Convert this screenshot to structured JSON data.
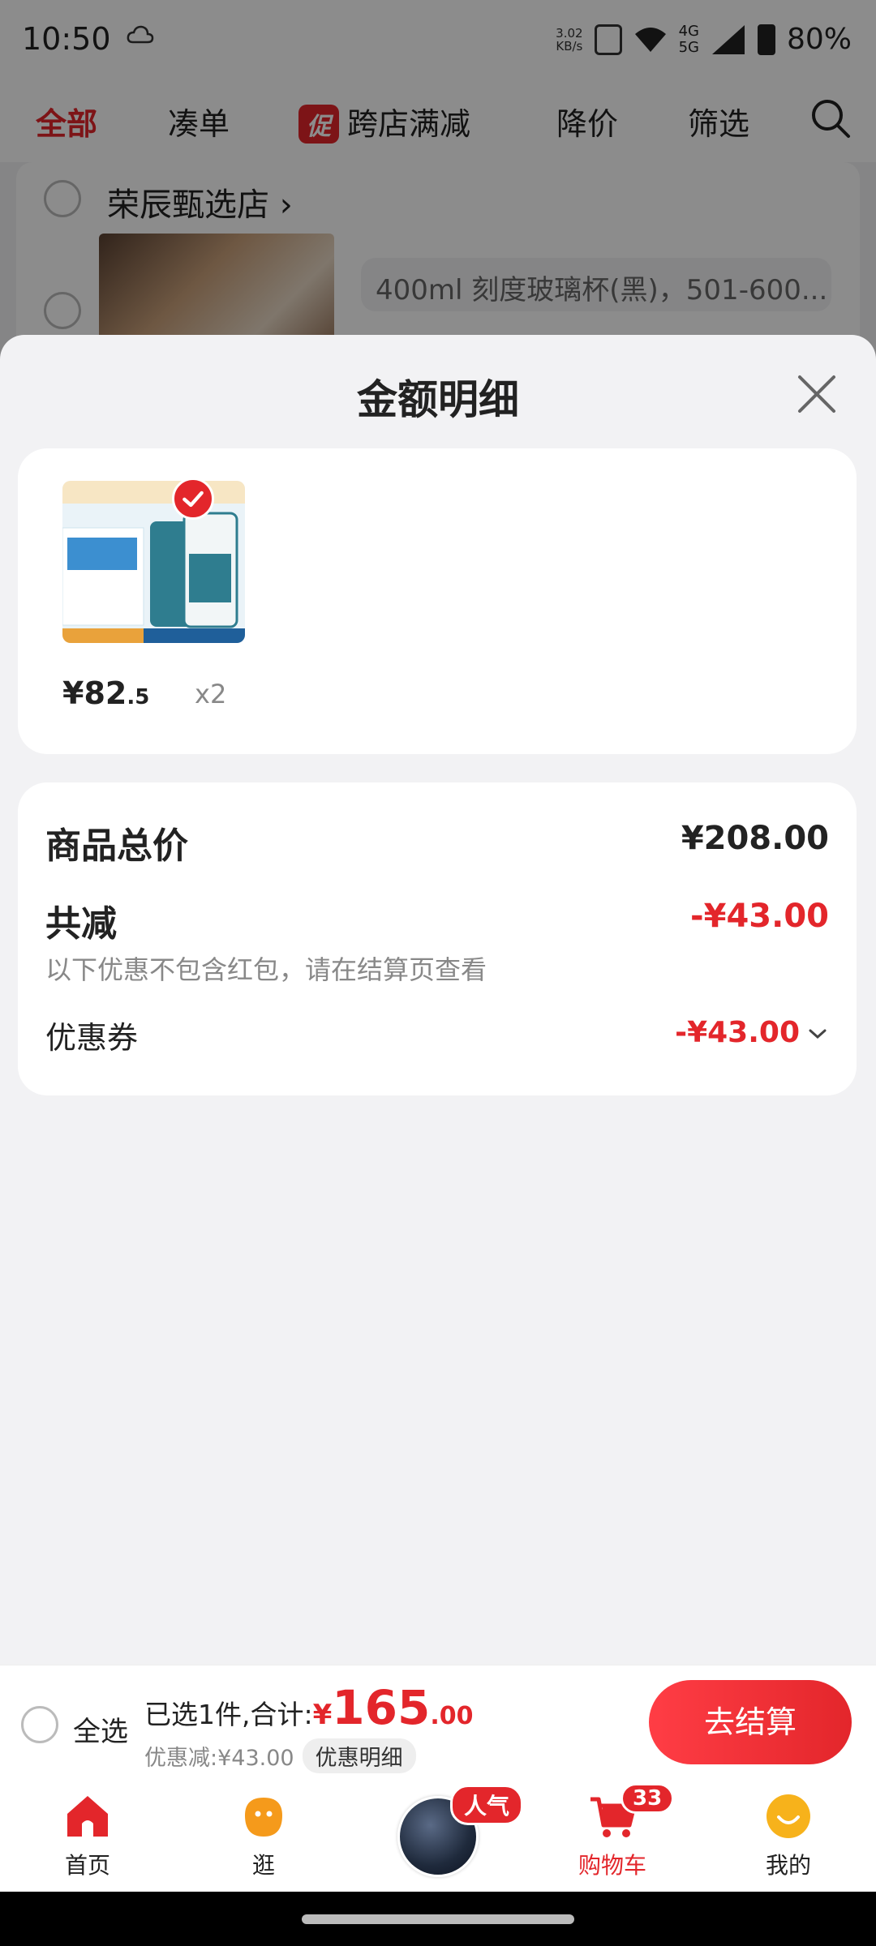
{
  "status_bar": {
    "time": "10:50",
    "net_speed_value": "3.02",
    "net_speed_unit": "KB/s",
    "net_type_top": "4G",
    "net_type_bottom": "5G",
    "battery": "80%"
  },
  "tabs": {
    "all": "全部",
    "bundle": "凑单",
    "promo_badge": "促",
    "cross_store": "跨店满减",
    "price_drop": "降价",
    "filter": "筛选"
  },
  "background_store": {
    "name": "荣辰甄选店",
    "spec": "400ml 刻度玻璃杯(黑)，501-600..."
  },
  "sheet": {
    "title": "金额明细",
    "item": {
      "price_main": "¥82",
      "price_decimal": ".5",
      "quantity": "x2"
    },
    "summary": {
      "total_label": "商品总价",
      "total_value": "¥208.00",
      "reduction_label": "共减",
      "reduction_value": "-¥43.00",
      "note": "以下优惠不包含红包，请在结算页查看",
      "coupon_label": "优惠券",
      "coupon_value": "-¥43.00"
    }
  },
  "action_bar": {
    "select_all": "全选",
    "selected_prefix": "已选1件,合计:",
    "currency": "¥",
    "total_integer": "165",
    "total_decimal": ".00",
    "discount_text": "优惠减:¥43.00",
    "detail_button": "优惠明细",
    "checkout": "去结算"
  },
  "bottom_nav": {
    "home": "首页",
    "browse": "逛",
    "popular_badge": "人气",
    "cart": "购物车",
    "cart_count": "33",
    "mine": "我的"
  },
  "colors": {
    "accent": "#e3262b"
  }
}
